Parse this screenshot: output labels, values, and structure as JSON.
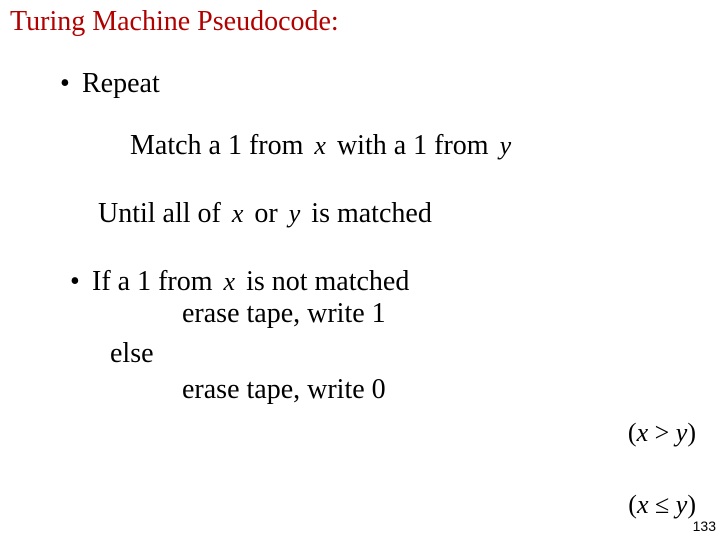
{
  "title": "Turing Machine Pseudocode:",
  "repeat_bullet": "•",
  "repeat_label": "Repeat",
  "match": {
    "pre": "Match a 1 from",
    "var1": "x",
    "mid": "with a 1 from",
    "var2": "y"
  },
  "until": {
    "pre": "Until all  of",
    "var1": "x",
    "or": "or",
    "var2": "y",
    "post": "is matched"
  },
  "if_block": {
    "bullet": "•",
    "pre": "If a 1 from",
    "var": "x",
    "post": "is not matched",
    "then_action": "erase tape, write 1",
    "else_label": "else",
    "else_action": "erase tape, write 0"
  },
  "conditions": {
    "gt": "(x > y)",
    "le": "(x ≤ y)"
  },
  "page_number": "133"
}
